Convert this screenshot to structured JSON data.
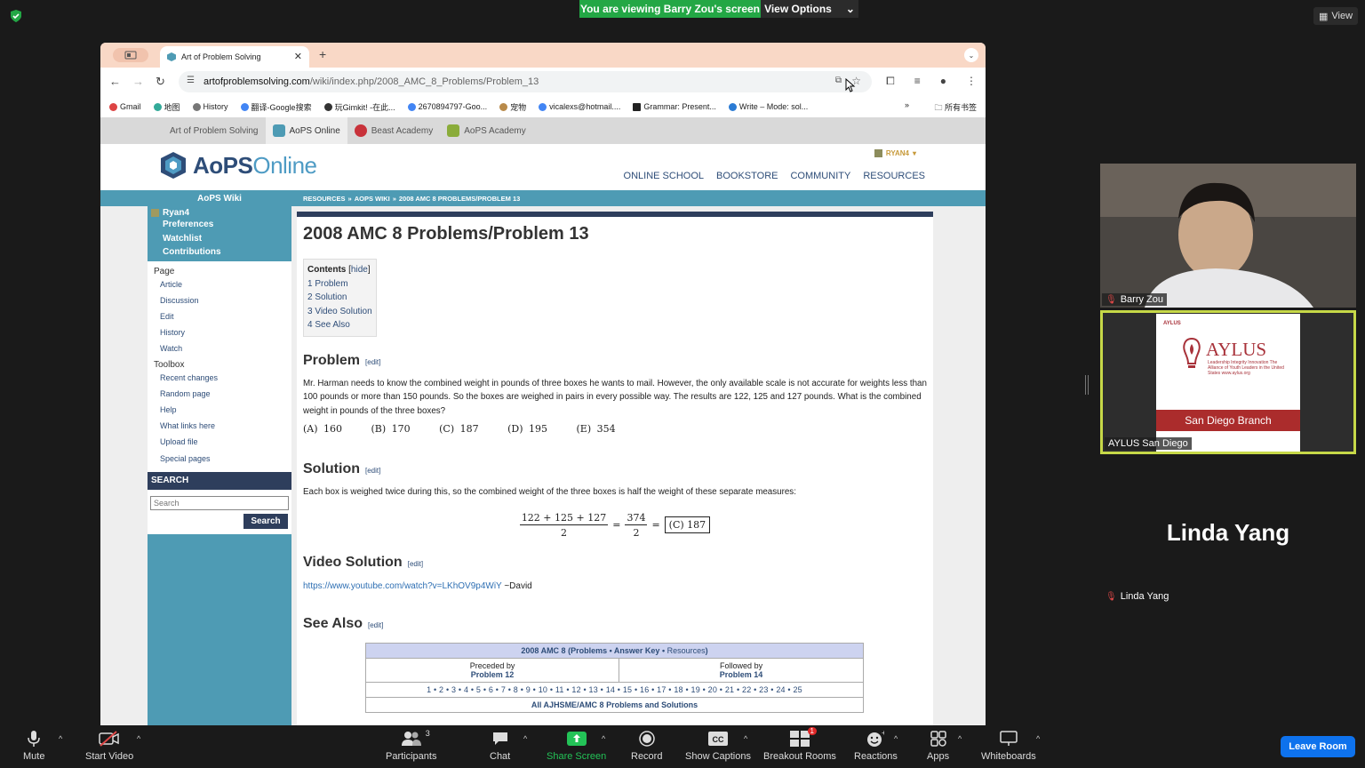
{
  "zoom": {
    "banner": "You are viewing Barry Zou's screen",
    "view_options": "View Options",
    "view_button": "View",
    "leave_button": "Leave Room",
    "toolbar": {
      "mute": "Mute",
      "start_video": "Start Video",
      "participants": "Participants",
      "participants_count": "3",
      "chat": "Chat",
      "share_screen": "Share Screen",
      "record": "Record",
      "show_captions": "Show Captions",
      "breakout_rooms": "Breakout Rooms",
      "breakout_badge": "1",
      "reactions": "Reactions",
      "apps": "Apps",
      "whiteboards": "Whiteboards"
    },
    "participants": [
      {
        "name": "Barry Zou"
      },
      {
        "name": "AYLUS San Diego"
      },
      {
        "name": "Linda Yang"
      }
    ],
    "aylus_card": {
      "small": "AYLUS",
      "big": "AYLUS",
      "sub": "Leadership Integrity Innovation The Alliance of Youth Leaders in the United States www.aylus.org",
      "band": "San Diego Branch"
    },
    "linda_tile_name": "Linda Yang"
  },
  "browser": {
    "tab_title": "Art of Problem Solving",
    "url_domain": "artofproblemsolving.com",
    "url_path": "/wiki/index.php/2008_AMC_8_Problems/Problem_13",
    "bookmarks": [
      "Gmail",
      "地图",
      "History",
      "翻译-Google搜索",
      "玩Gimkit! -在此...",
      "2670894797-Goo...",
      "宠物",
      "vicalexs@hotmail....",
      "Grammar: Present...",
      "Write – Mode: sol..."
    ],
    "all_bookmarks": "所有书签"
  },
  "site": {
    "tabs": [
      "Art of Problem Solving",
      "AoPS Online",
      "Beast Academy",
      "AoPS Academy"
    ],
    "logo_a": "AoPS",
    "logo_b": "Online",
    "user": "RYAN4",
    "nav": [
      "ONLINE SCHOOL",
      "BOOKSTORE",
      "COMMUNITY",
      "RESOURCES"
    ],
    "wiki_title": "AoPS Wiki",
    "breadcrumb": [
      "RESOURCES",
      "AOPS WIKI",
      "2008 AMC 8 PROBLEMS/PROBLEM 13"
    ],
    "sidebar": {
      "username": "Ryan4",
      "user_links": [
        "Preferences",
        "Watchlist",
        "Contributions"
      ],
      "page_h": "Page",
      "page_links": [
        "Article",
        "Discussion",
        "Edit",
        "History",
        "Watch"
      ],
      "toolbox_h": "Toolbox",
      "toolbox_links": [
        "Recent changes",
        "Random page",
        "Help",
        "What links here",
        "Upload file",
        "Special pages"
      ],
      "search_h": "SEARCH",
      "search_placeholder": "Search",
      "search_button": "Search"
    },
    "article": {
      "title": "2008 AMC 8 Problems/Problem 13",
      "toc_title": "Contents",
      "toc_hide": "hide",
      "toc": [
        "1 Problem",
        "2 Solution",
        "3 Video Solution",
        "4 See Also"
      ],
      "edit": "edit",
      "problem_h": "Problem",
      "problem_text": "Mr. Harman needs to know the combined weight in pounds of three boxes he wants to mail. However, the only available scale is not accurate for weights less than 100 pounds or more than 150 pounds. So the boxes are weighed in pairs in every possible way. The results are 122, 125 and 127 pounds. What is the combined weight in pounds of the three boxes?",
      "choices": "(A) 160     (B) 170     (C) 187     (D) 195     (E) 354",
      "solution_h": "Solution",
      "solution_text": "Each box is weighed twice during this, so the combined weight of the three boxes is half the weight of these separate measures:",
      "math_num1": "122 + 125 + 127",
      "math_den1": "2",
      "math_num2": "374",
      "math_den2": "2",
      "math_eq": "=",
      "math_boxed": "(C) 187",
      "video_h": "Video Solution",
      "video_link": "https://www.youtube.com/watch?v=LKhOV9p4WiY",
      "video_author": " ~David",
      "see_also_h": "See Also",
      "nav_header_a": "2008 AMC 8 (",
      "nav_header_problems": "Problems",
      "nav_header_key": "Answer Key",
      "nav_header_res": "Resources",
      "preceded_by": "Preceded by",
      "preceded_link": "Problem 12",
      "followed_by": "Followed by",
      "followed_link": "Problem 14",
      "numbers": "1 • 2 • 3 • 4 • 5 • 6 • 7 • 8 • 9 • 10 • 11 • 12 • 13 • 14 • 15 • 16 • 17 • 18 • 19 • 20 • 21 • 22 • 23 • 24 • 25",
      "all_link": "All AJHSME/AMC 8 Problems and Solutions"
    }
  }
}
